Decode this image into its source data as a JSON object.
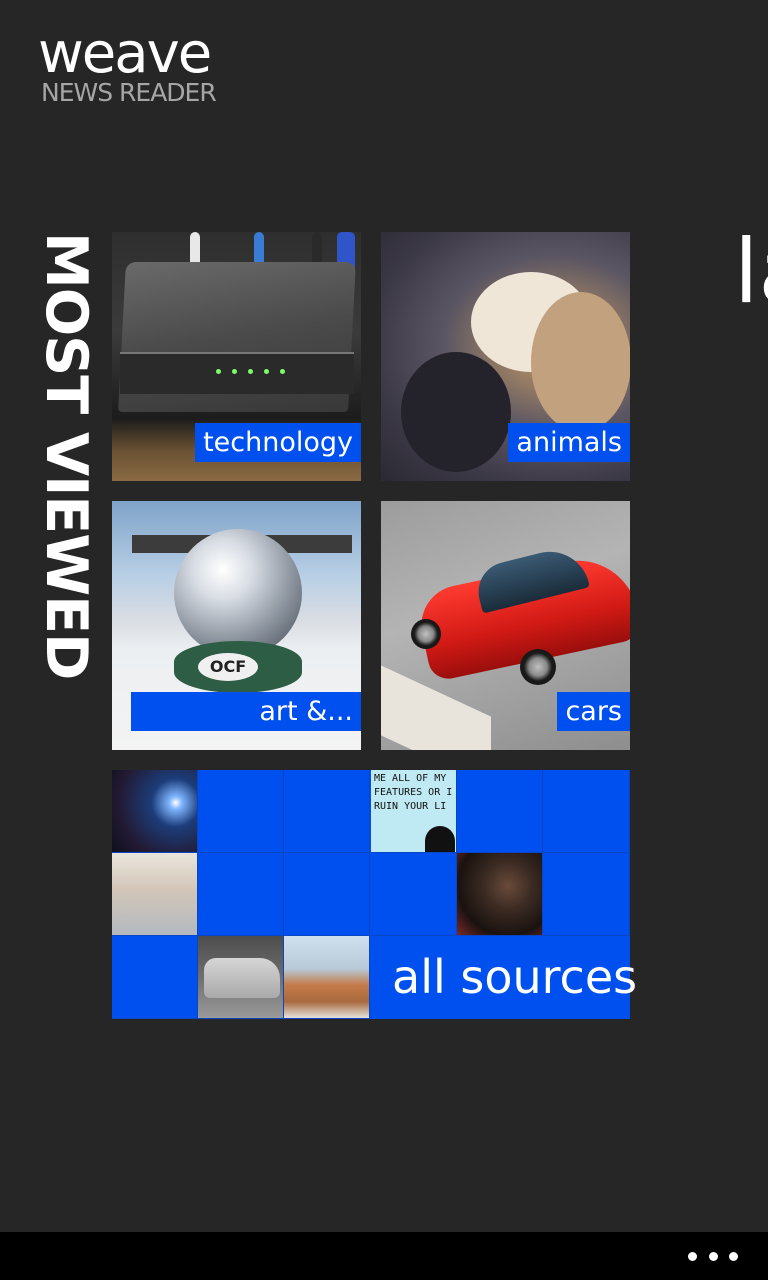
{
  "app": {
    "name": "weave",
    "subtitle": "NEWS READER"
  },
  "section": {
    "header": "MOST VIEWED",
    "next_header_peek": "la"
  },
  "tiles": [
    {
      "label": "technology",
      "image": "cable-modem-photo"
    },
    {
      "label": "animals",
      "image": "cat-paw-photo"
    },
    {
      "label": "art &...",
      "image": "reflective-sphere-photo"
    },
    {
      "label": "cars",
      "image": "red-sports-car-photo"
    }
  ],
  "mosaic": {
    "label": "all sources",
    "comic_text": "ME ALL OF MY FEATURES OR I RUIN YOUR LI",
    "cells": [
      "space-photo",
      "comic-strip",
      "figurines-photo",
      "basketball-player-photo",
      "van-photo",
      "street-building-photo"
    ]
  },
  "app_bar": {
    "more_icon": "ellipsis-icon"
  },
  "colors": {
    "background": "#262626",
    "accent": "#0050ef",
    "app_bar": "#000000",
    "subtitle": "#a6a6a6"
  }
}
